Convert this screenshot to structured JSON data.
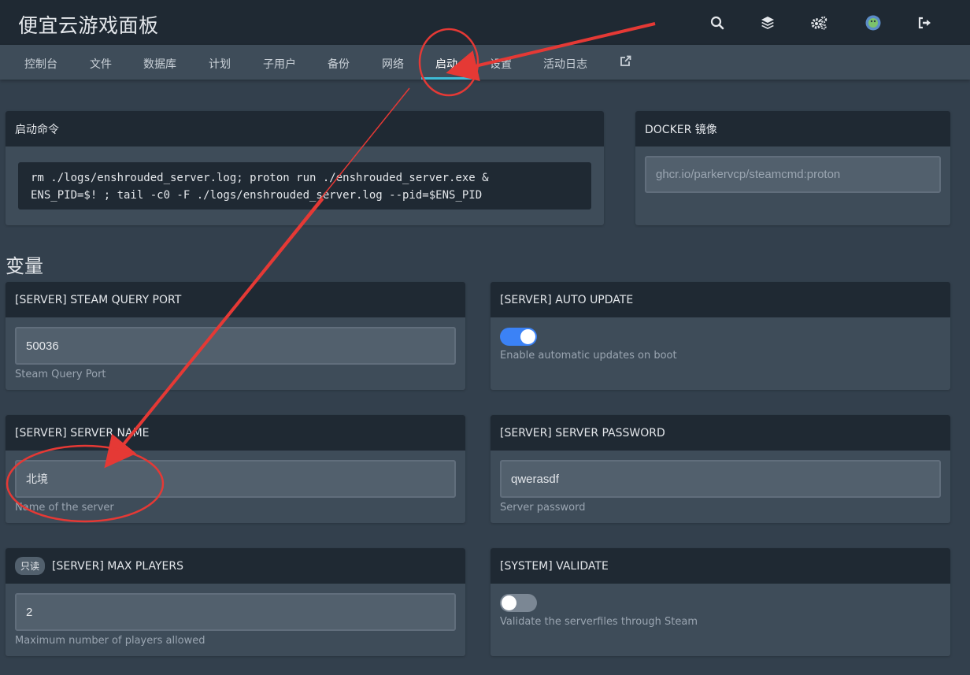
{
  "app": {
    "title": "便宜云游戏面板"
  },
  "header_icons": [
    "search-icon",
    "layers-icon",
    "cogs-icon",
    "avatar",
    "logout-icon"
  ],
  "nav": {
    "tabs": [
      {
        "label": "控制台"
      },
      {
        "label": "文件"
      },
      {
        "label": "数据库"
      },
      {
        "label": "计划"
      },
      {
        "label": "子用户"
      },
      {
        "label": "备份"
      },
      {
        "label": "网络"
      },
      {
        "label": "启动"
      },
      {
        "label": "设置"
      },
      {
        "label": "活动日志"
      }
    ],
    "active_tab": "启动"
  },
  "startup": {
    "heading": "启动命令",
    "command_line1": "rm ./logs/enshrouded_server.log; proton run ./enshrouded_server.exe &",
    "command_line2": "ENS_PID=$! ; tail -c0 -F ./logs/enshrouded_server.log --pid=$ENS_PID"
  },
  "docker": {
    "heading": "DOCKER 镜像",
    "value": "ghcr.io/parkervcp/steamcmd:proton"
  },
  "variables": {
    "title": "变量",
    "query_port": {
      "heading": "[SERVER] STEAM QUERY PORT",
      "value": "50036",
      "help": "Steam Query Port"
    },
    "auto_update": {
      "heading": "[SERVER] AUTO UPDATE",
      "enabled": true,
      "help": "Enable automatic updates on boot"
    },
    "server_name": {
      "heading": "[SERVER] SERVER NAME",
      "value": "北境",
      "help": "Name of the server"
    },
    "server_password": {
      "heading": "[SERVER] SERVER PASSWORD",
      "value": "qwerasdf",
      "help": "Server password"
    },
    "max_players": {
      "badge": "只读",
      "heading": "[SERVER] MAX PLAYERS",
      "value": "2",
      "help": "Maximum number of players allowed"
    },
    "validate": {
      "heading": "[SYSTEM] VALIDATE",
      "enabled": false,
      "help": "Validate the serverfiles through Steam"
    }
  },
  "colors": {
    "topbar": "#1f2933",
    "navbar": "#3e4c59",
    "background": "#33404d",
    "accent": "#3ebbd6",
    "toggle_on": "#3b82f6",
    "annotation": "#e53935"
  }
}
